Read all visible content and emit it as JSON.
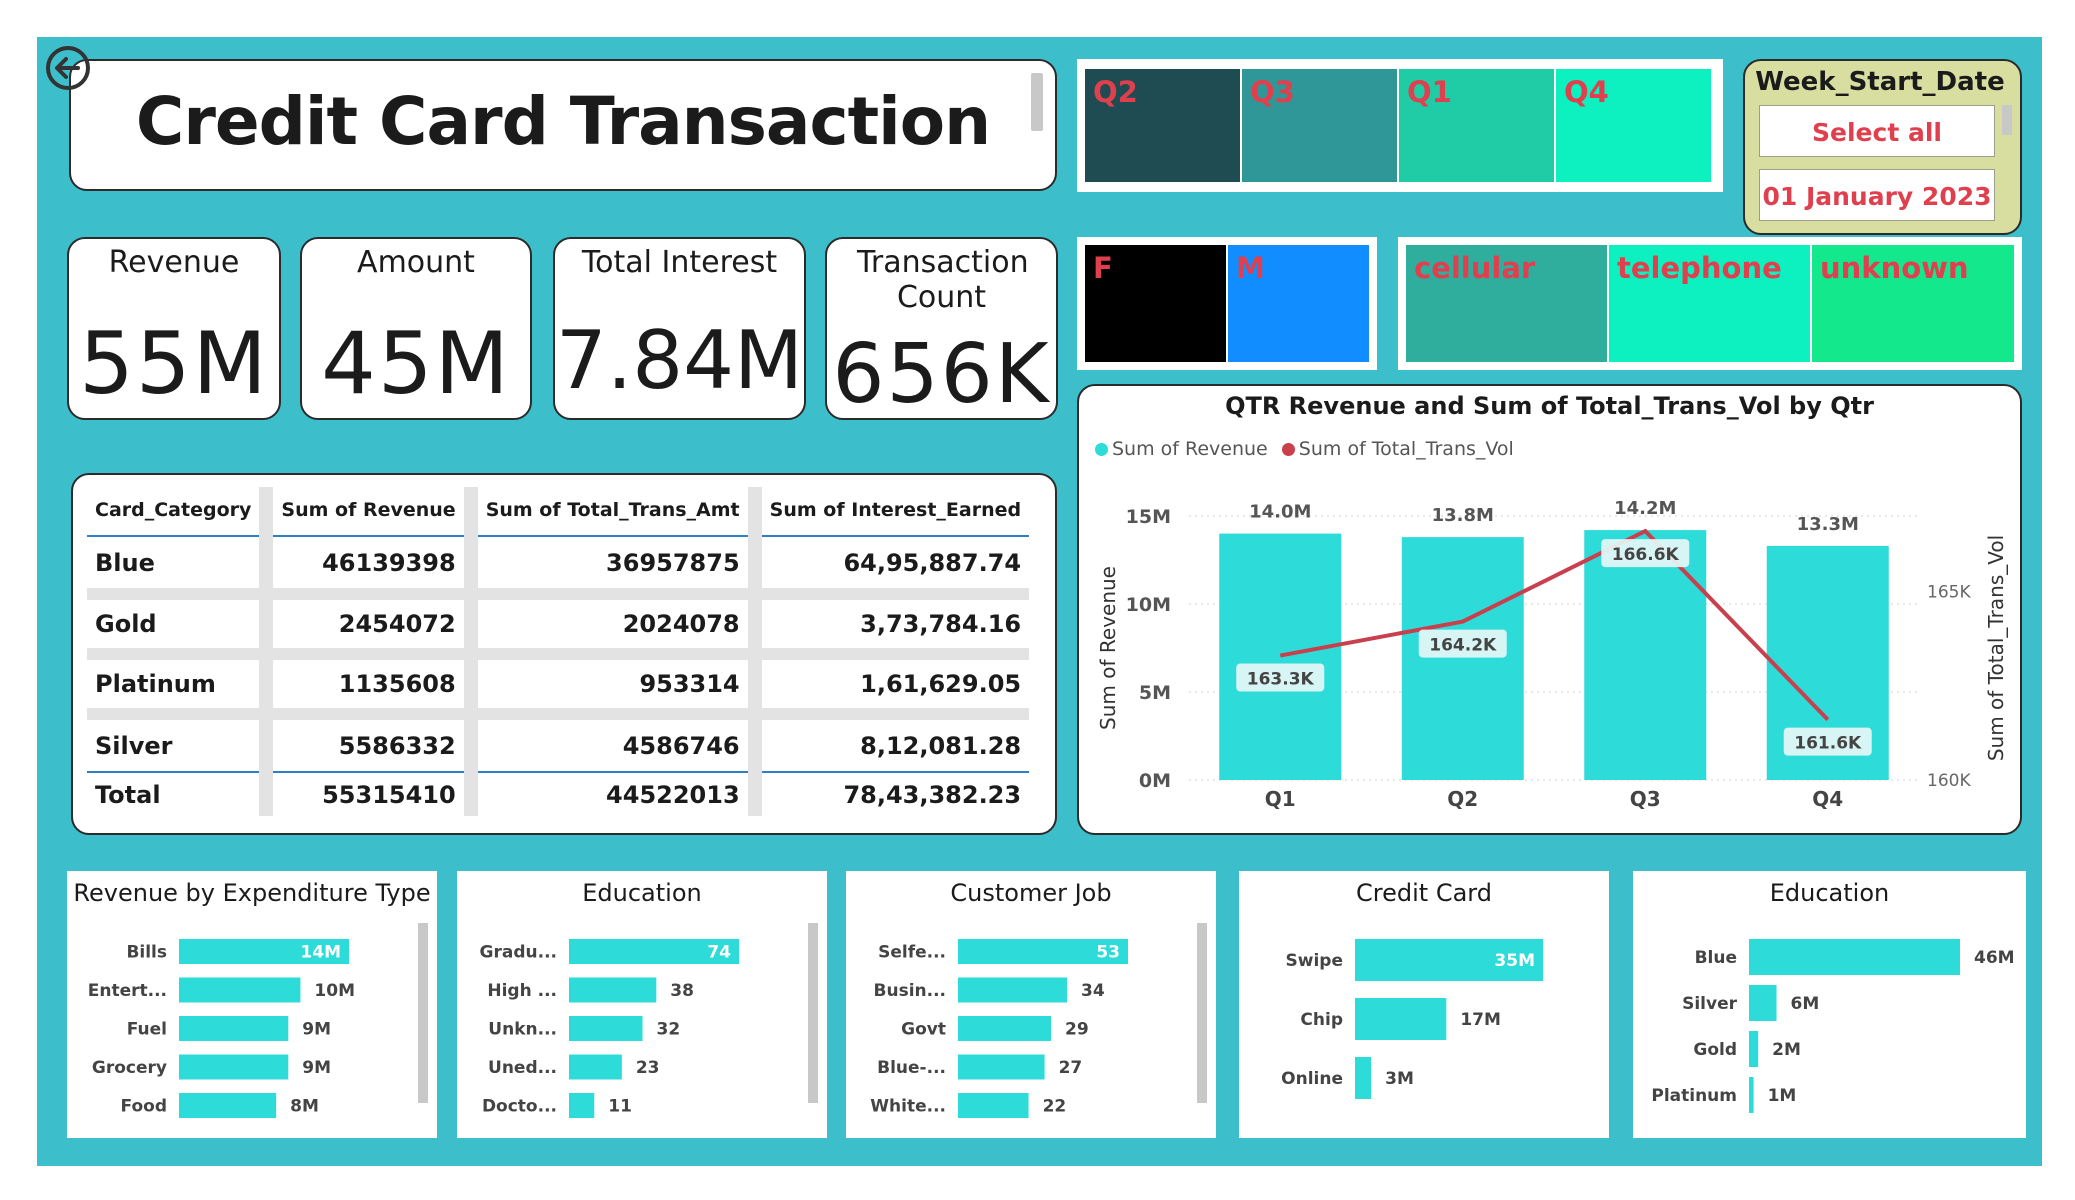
{
  "header": {
    "title": "Credit Card Transaction"
  },
  "kpis": {
    "revenue": {
      "label": "Revenue",
      "value": "55M"
    },
    "amount": {
      "label": "Amount",
      "value": "45M"
    },
    "interest": {
      "label": "Total Interest",
      "value": "7.84M"
    },
    "count": {
      "label": "Transaction Count",
      "value": "656K"
    }
  },
  "slicers": {
    "quarters": [
      "Q2",
      "Q3",
      "Q1",
      "Q4"
    ],
    "gender": [
      "F",
      "M"
    ],
    "contact": [
      "cellular",
      "telephone",
      "unknown"
    ],
    "week": {
      "title": "Week_Start_Date",
      "items": [
        "Select all",
        "01 January 2023"
      ]
    }
  },
  "colors": {
    "accent": "#2ddbd9",
    "line": "#c8404e",
    "background": "#3dbecb",
    "q2": "#1f4c52",
    "q3": "#2f9797",
    "q1": "#1fcca6",
    "q4": "#0df0c0",
    "f": "#000000",
    "m": "#118dff",
    "cellular": "#2fae9e",
    "telephone": "#0df0c0",
    "unknown": "#13e88c"
  },
  "table": {
    "headers": [
      "Card_Category",
      "Sum of Revenue",
      "Sum of Total_Trans_Amt",
      "Sum of Interest_Earned"
    ],
    "rows": [
      [
        "Blue",
        "46139398",
        "36957875",
        "64,95,887.74"
      ],
      [
        "Gold",
        "2454072",
        "2024078",
        "3,73,784.16"
      ],
      [
        "Platinum",
        "1135608",
        "953314",
        "1,61,629.05"
      ],
      [
        "Silver",
        "5586332",
        "4586746",
        "8,12,081.28"
      ]
    ],
    "total": [
      "Total",
      "55315410",
      "44522013",
      "78,43,382.23"
    ]
  },
  "chart_data": [
    {
      "type": "bar",
      "title": "QTR Revenue and Sum of Total_Trans_Vol by Qtr",
      "legend": [
        "Sum of Revenue",
        "Sum of Total_Trans_Vol"
      ],
      "legend_position": "top-left",
      "categories": [
        "Q1",
        "Q2",
        "Q3",
        "Q4"
      ],
      "series": [
        {
          "name": "Sum of Revenue",
          "kind": "bar",
          "values": [
            14.0,
            13.8,
            14.2,
            13.3
          ],
          "labels": [
            "14.0M",
            "13.8M",
            "14.2M",
            "13.3M"
          ],
          "color": "#2ddbd9"
        },
        {
          "name": "Sum of Total_Trans_Vol",
          "kind": "line",
          "values": [
            163.3,
            164.2,
            166.6,
            161.6
          ],
          "labels": [
            "163.3K",
            "164.2K",
            "166.6K",
            "161.6K"
          ],
          "color": "#c8404e"
        }
      ],
      "ylabel": "Sum of Revenue",
      "y2label": "Sum of Total_Trans_Vol",
      "ylim": [
        0,
        15
      ],
      "yticks": [
        "0M",
        "5M",
        "10M",
        "15M"
      ],
      "y2lim": [
        160,
        167
      ],
      "y2ticks": [
        "160K",
        "165K"
      ],
      "grid": true
    },
    {
      "type": "bar",
      "orientation": "horizontal",
      "title": "Revenue by Expenditure Type",
      "categories": [
        "Bills",
        "Entert...",
        "Fuel",
        "Grocery",
        "Food"
      ],
      "values": [
        14,
        10,
        9,
        9,
        8
      ],
      "labels": [
        "14M",
        "10M",
        "9M",
        "9M",
        "8M"
      ]
    },
    {
      "type": "bar",
      "orientation": "horizontal",
      "title": "Education",
      "categories": [
        "Gradu...",
        "High ...",
        "Unkn...",
        "Uned...",
        "Docto..."
      ],
      "values": [
        74,
        38,
        32,
        23,
        11
      ],
      "labels": [
        "74",
        "38",
        "32",
        "23",
        "11"
      ]
    },
    {
      "type": "bar",
      "orientation": "horizontal",
      "title": "Customer Job",
      "categories": [
        "Selfe...",
        "Busin...",
        "Govt",
        "Blue-...",
        "White..."
      ],
      "values": [
        53,
        34,
        29,
        27,
        22
      ],
      "labels": [
        "53",
        "34",
        "29",
        "27",
        "22"
      ]
    },
    {
      "type": "bar",
      "orientation": "horizontal",
      "title": "Credit Card",
      "categories": [
        "Swipe",
        "Chip",
        "Online"
      ],
      "values": [
        35,
        17,
        3
      ],
      "labels": [
        "35M",
        "17M",
        "3M"
      ]
    },
    {
      "type": "bar",
      "orientation": "horizontal",
      "title": "Education",
      "categories": [
        "Blue",
        "Silver",
        "Gold",
        "Platinum"
      ],
      "values": [
        46,
        6,
        2,
        1
      ],
      "labels": [
        "46M",
        "6M",
        "2M",
        "1M"
      ]
    }
  ]
}
